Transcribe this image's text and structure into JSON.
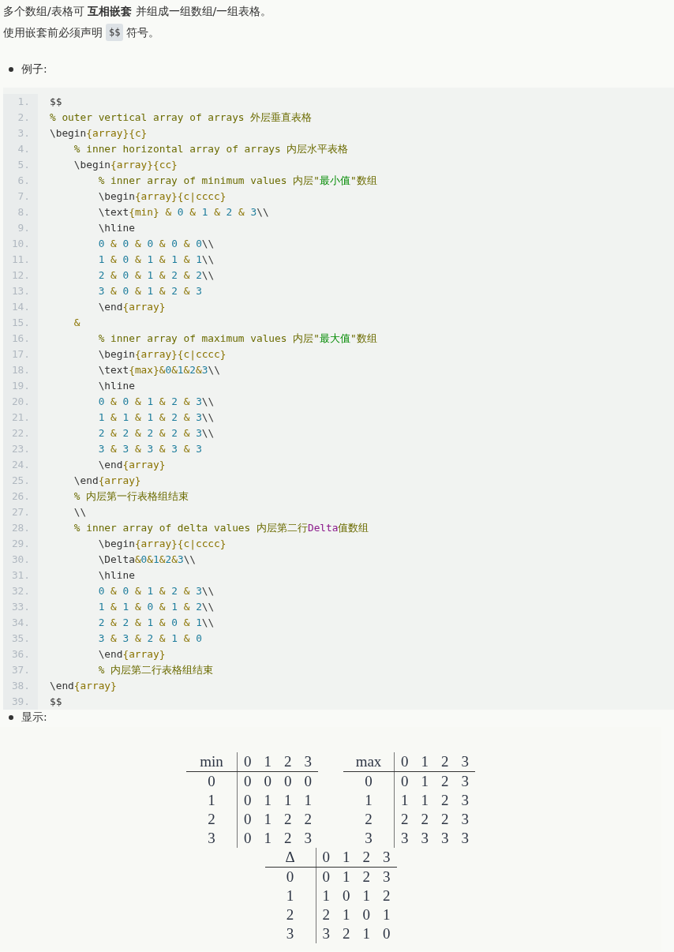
{
  "intro": {
    "text": "多个数组/表格可 **互相嵌套** 并组成一组数组/一组表格。"
  },
  "note": {
    "before": "使用嵌套前必须声明",
    "code": "$$",
    "after": "符号。"
  },
  "example_label": "例子:",
  "code_lines": [
    {
      "no": "1.",
      "segs": [
        {
          "kind": "code",
          "text": "$$"
        }
      ]
    },
    {
      "no": "2.",
      "segs": [
        {
          "kind": "comment",
          "text": "% outer vertical array of arrays 外层垂直表格"
        }
      ]
    },
    {
      "no": "3.",
      "segs": [
        {
          "kind": "code",
          "text": "\\begin{array}{c}"
        }
      ]
    },
    {
      "no": "4.",
      "segs": [
        {
          "kind": "comment",
          "text": "    % inner horizontal array of arrays 内层水平表格"
        }
      ]
    },
    {
      "no": "5.",
      "segs": [
        {
          "kind": "code",
          "text": "    \\begin{array}{cc}"
        }
      ]
    },
    {
      "no": "6.",
      "segs": [
        {
          "kind": "comment",
          "text": "        % inner array of minimum values 内层\""
        },
        {
          "kind": "string",
          "text": "最小值"
        },
        {
          "kind": "comment",
          "text": "\"数组"
        }
      ]
    },
    {
      "no": "7.",
      "segs": [
        {
          "kind": "code",
          "text": "        \\begin{array}{c|cccc}"
        }
      ]
    },
    {
      "no": "8.",
      "segs": [
        {
          "kind": "code",
          "text": "        \\text{min} & 0 & 1 & 2 & 3\\\\"
        }
      ]
    },
    {
      "no": "9.",
      "segs": [
        {
          "kind": "code",
          "text": "        \\hline"
        }
      ]
    },
    {
      "no": "10.",
      "segs": [
        {
          "kind": "code",
          "text": "        0 & 0 & 0 & 0 & 0\\\\"
        }
      ]
    },
    {
      "no": "11.",
      "segs": [
        {
          "kind": "code",
          "text": "        1 & 0 & 1 & 1 & 1\\\\"
        }
      ]
    },
    {
      "no": "12.",
      "segs": [
        {
          "kind": "code",
          "text": "        2 & 0 & 1 & 2 & 2\\\\"
        }
      ]
    },
    {
      "no": "13.",
      "segs": [
        {
          "kind": "code",
          "text": "        3 & 0 & 1 & 2 & 3"
        }
      ]
    },
    {
      "no": "14.",
      "segs": [
        {
          "kind": "code",
          "text": "        \\end{array}"
        }
      ]
    },
    {
      "no": "15.",
      "segs": [
        {
          "kind": "code",
          "text": "    &"
        }
      ]
    },
    {
      "no": "16.",
      "segs": [
        {
          "kind": "comment",
          "text": "        % inner array of maximum values 内层\""
        },
        {
          "kind": "string",
          "text": "最大值"
        },
        {
          "kind": "comment",
          "text": "\"数组"
        }
      ]
    },
    {
      "no": "17.",
      "segs": [
        {
          "kind": "code",
          "text": "        \\begin{array}{c|cccc}"
        }
      ]
    },
    {
      "no": "18.",
      "segs": [
        {
          "kind": "code",
          "text": "        \\text{max}&0&1&2&3\\\\"
        }
      ]
    },
    {
      "no": "19.",
      "segs": [
        {
          "kind": "code",
          "text": "        \\hline"
        }
      ]
    },
    {
      "no": "20.",
      "segs": [
        {
          "kind": "code",
          "text": "        0 & 0 & 1 & 2 & 3\\\\"
        }
      ]
    },
    {
      "no": "21.",
      "segs": [
        {
          "kind": "code",
          "text": "        1 & 1 & 1 & 2 & 3\\\\"
        }
      ]
    },
    {
      "no": "22.",
      "segs": [
        {
          "kind": "code",
          "text": "        2 & 2 & 2 & 2 & 3\\\\"
        }
      ]
    },
    {
      "no": "23.",
      "segs": [
        {
          "kind": "code",
          "text": "        3 & 3 & 3 & 3 & 3"
        }
      ]
    },
    {
      "no": "24.",
      "segs": [
        {
          "kind": "code",
          "text": "        \\end{array}"
        }
      ]
    },
    {
      "no": "25.",
      "segs": [
        {
          "kind": "code",
          "text": "    \\end{array}"
        }
      ]
    },
    {
      "no": "26.",
      "segs": [
        {
          "kind": "comment",
          "text": "    % 内层第一行表格组结束"
        }
      ]
    },
    {
      "no": "27.",
      "segs": [
        {
          "kind": "code",
          "text": "    \\\\"
        }
      ]
    },
    {
      "no": "28.",
      "segs": [
        {
          "kind": "comment",
          "text": "    % inner array of delta values 内层第二行"
        },
        {
          "kind": "symbol",
          "text": "Delta"
        },
        {
          "kind": "comment",
          "text": "值数组"
        }
      ]
    },
    {
      "no": "29.",
      "segs": [
        {
          "kind": "code",
          "text": "        \\begin{array}{c|cccc}"
        }
      ]
    },
    {
      "no": "30.",
      "segs": [
        {
          "kind": "code",
          "text": "        \\Delta&0&1&2&3\\\\"
        }
      ]
    },
    {
      "no": "31.",
      "segs": [
        {
          "kind": "code",
          "text": "        \\hline"
        }
      ]
    },
    {
      "no": "32.",
      "segs": [
        {
          "kind": "code",
          "text": "        0 & 0 & 1 & 2 & 3\\\\"
        }
      ]
    },
    {
      "no": "33.",
      "segs": [
        {
          "kind": "code",
          "text": "        1 & 1 & 0 & 1 & 2\\\\"
        }
      ]
    },
    {
      "no": "34.",
      "segs": [
        {
          "kind": "code",
          "text": "        2 & 2 & 1 & 0 & 1\\\\"
        }
      ]
    },
    {
      "no": "35.",
      "segs": [
        {
          "kind": "code",
          "text": "        3 & 3 & 2 & 1 & 0"
        }
      ]
    },
    {
      "no": "36.",
      "segs": [
        {
          "kind": "code",
          "text": "        \\end{array}"
        }
      ]
    },
    {
      "no": "37.",
      "segs": [
        {
          "kind": "comment",
          "text": "        % 内层第二行表格组结束"
        }
      ]
    },
    {
      "no": "38.",
      "segs": [
        {
          "kind": "code",
          "text": "\\end{array}"
        }
      ]
    },
    {
      "no": "39.",
      "segs": [
        {
          "kind": "code",
          "text": "$$"
        }
      ]
    }
  ],
  "display_label": "显示:",
  "display_rows": [
    [
      {
        "header": [
          "min",
          "0",
          "1",
          "2",
          "3"
        ],
        "rows": [
          [
            "0",
            "0",
            "0",
            "0",
            "0"
          ],
          [
            "1",
            "0",
            "1",
            "1",
            "1"
          ],
          [
            "2",
            "0",
            "1",
            "2",
            "2"
          ],
          [
            "3",
            "0",
            "1",
            "2",
            "3"
          ]
        ]
      },
      {
        "header": [
          "max",
          "0",
          "1",
          "2",
          "3"
        ],
        "rows": [
          [
            "0",
            "0",
            "1",
            "2",
            "3"
          ],
          [
            "1",
            "1",
            "1",
            "2",
            "3"
          ],
          [
            "2",
            "2",
            "2",
            "2",
            "3"
          ],
          [
            "3",
            "3",
            "3",
            "3",
            "3"
          ]
        ]
      }
    ],
    [
      {
        "header": [
          "Δ",
          "0",
          "1",
          "2",
          "3"
        ],
        "rows": [
          [
            "0",
            "0",
            "1",
            "2",
            "3"
          ],
          [
            "1",
            "1",
            "0",
            "1",
            "2"
          ],
          [
            "2",
            "2",
            "1",
            "0",
            "1"
          ],
          [
            "3",
            "3",
            "2",
            "1",
            "0"
          ]
        ]
      }
    ]
  ]
}
